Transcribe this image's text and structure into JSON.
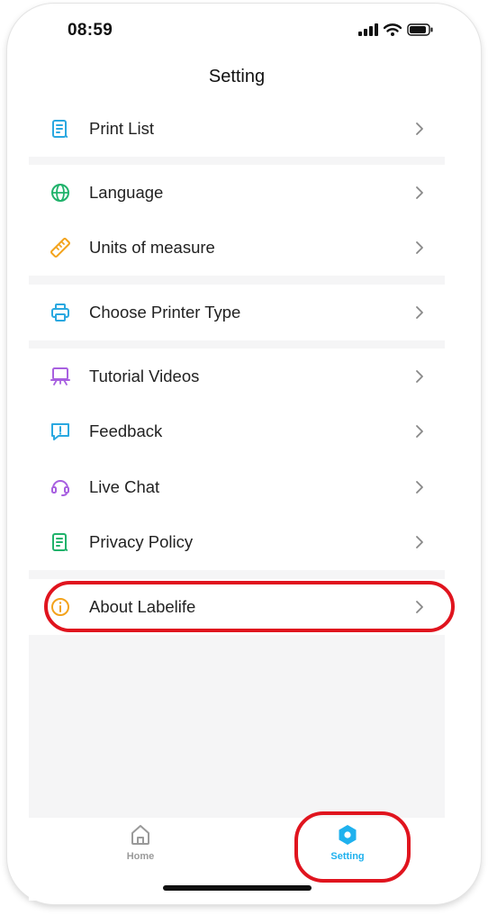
{
  "status_bar": {
    "time": "08:59"
  },
  "header": {
    "title": "Setting"
  },
  "menu": {
    "print_list": "Print List",
    "language": "Language",
    "units": "Units of measure",
    "printer_type": "Choose Printer Type",
    "tutorial": "Tutorial Videos",
    "feedback": "Feedback",
    "live_chat": "Live Chat",
    "privacy": "Privacy Policy",
    "about": "About Labelife"
  },
  "tabbar": {
    "home": "Home",
    "setting": "Setting",
    "active": "Setting"
  },
  "colors": {
    "accent": "#1fb1ee",
    "highlight": "#e0141e",
    "inactive_tab": "#9a9a9a",
    "icon_blue": "#2aa8e0",
    "icon_green": "#20b26b",
    "icon_orange": "#f3a31c",
    "icon_purple": "#a860e0"
  },
  "icons": {
    "print_list": "document-list-icon",
    "language": "globe-icon",
    "units": "ruler-icon",
    "printer_type": "printer-icon",
    "tutorial": "video-presentation-icon",
    "feedback": "feedback-bubble-icon",
    "live_chat": "headset-icon",
    "privacy": "policy-document-icon",
    "about": "info-icon",
    "home": "home-icon",
    "setting": "hexagon-settings-icon"
  }
}
